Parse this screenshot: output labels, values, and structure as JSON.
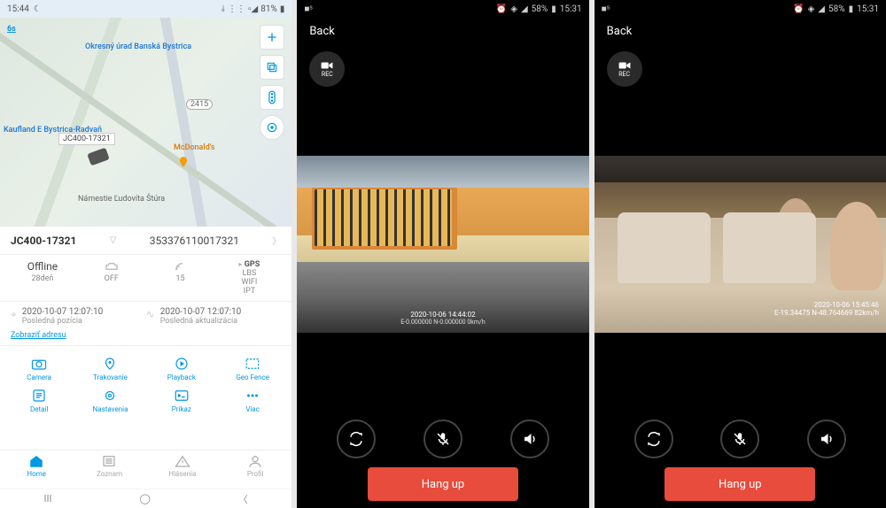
{
  "screen1": {
    "status": {
      "time": "15:44",
      "battery": "81%"
    },
    "map": {
      "track_badge": "6s",
      "poi_okresny": "Okresný úrad\nBanská Bystrica",
      "poi_kaufland": "Kaufland E\nBystrica-Radvaň",
      "poi_mcd": "McDonald's",
      "device_tip": "JC400-17321",
      "road_label": "Námestie Ľudovíta Štúra",
      "road_2415": "2415"
    },
    "header": {
      "device": "JC400-17321",
      "imei": "353376110017321"
    },
    "status_cells": {
      "offline": {
        "val": "Offline",
        "sub": "28deň"
      },
      "acc": {
        "sub": "OFF"
      },
      "sat": {
        "sub": "15"
      },
      "gps": {
        "marker": "▸",
        "val": "GPS",
        "s1": "LBS",
        "s2": "WIFI",
        "s3": "IPT"
      }
    },
    "times": {
      "pos": {
        "ts": "2020-10-07 12:07:10",
        "label": "Posledná pozícia"
      },
      "upd": {
        "ts": "2020-10-07 12:07:10",
        "label": "Posledná aktualizácia"
      }
    },
    "addr_link": "Zobraziť adresu",
    "actions": {
      "camera": "Camera",
      "tracking": "Trakovanie",
      "playback": "Playback",
      "geofence": "Geo Fence",
      "detail": "Detail",
      "settings": "Nastavenia",
      "command": "Príkaz",
      "more": "Viac"
    },
    "nav": {
      "home": "Home",
      "list": "Zoznam",
      "alerts": "Hlásenia",
      "profile": "Profil"
    }
  },
  "screen2": {
    "status": {
      "time": "15:31",
      "battery": "58%"
    },
    "back": "Back",
    "rec": "REC",
    "overlay": {
      "ts": "2020-10-06   14:44:02",
      "gps": "E-0.000000  N-0.000000     0km/h"
    },
    "hangup": "Hang up"
  },
  "screen3": {
    "status": {
      "time": "15:31",
      "battery": "58%"
    },
    "back": "Back",
    "rec": "REC",
    "overlay": {
      "ts": "2020-10-06   15:45:46",
      "gps": "E-19.34475  N-48.764669     82km/h"
    },
    "hangup": "Hang up"
  }
}
